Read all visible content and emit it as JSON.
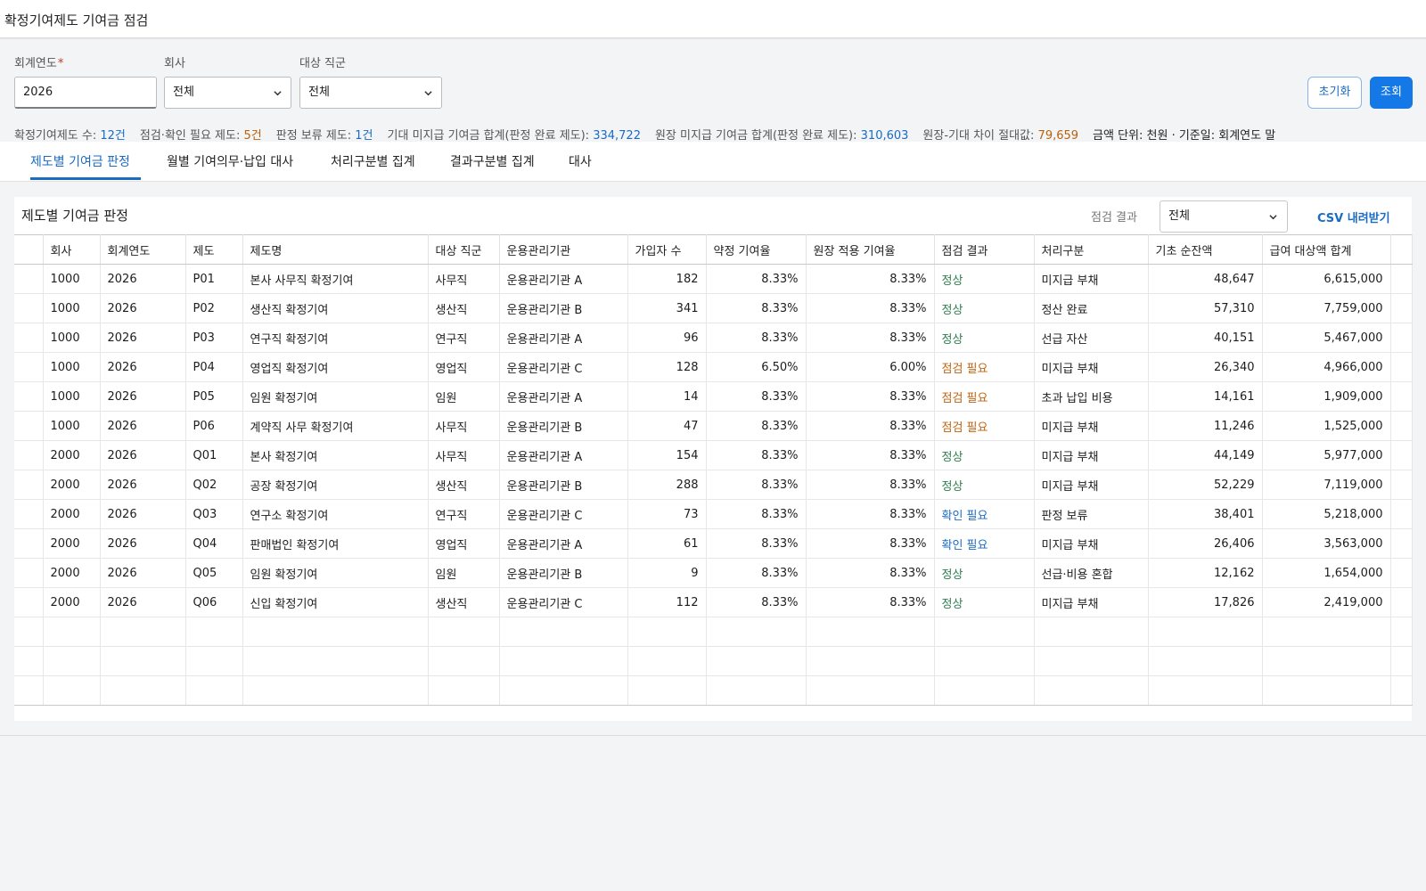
{
  "window": {
    "title": "확정기여제도 기여금 점검"
  },
  "filters": {
    "fiscal_year": {
      "label": "회계연도",
      "required_mark": "*",
      "value": "2026"
    },
    "company": {
      "label": "회사",
      "value": "전체"
    },
    "job_group": {
      "label": "대상 직군",
      "value": "전체"
    }
  },
  "buttons": {
    "reset": "초기화",
    "search": "조회"
  },
  "summary": {
    "plan_count_label": "확정기여제도 수:",
    "plan_count": "12건",
    "needs_check_label": "점검·확인 필요 제도:",
    "needs_check": "5건",
    "on_hold_label": "판정 보류 제도:",
    "on_hold": "1건",
    "expected_unpaid_label": "기대 미지급 기여금 합계(판정 완료 제도):",
    "expected_unpaid": "334,722",
    "ledger_unpaid_label": "원장 미지급 기여금 합계(판정 완료 제도):",
    "ledger_unpaid": "310,603",
    "diff_label": "원장-기대 차이 절대값:",
    "diff": "79,659",
    "unit_note": "금액 단위: 천원 · 기준일: 회계연도 말"
  },
  "tabs": [
    {
      "label": "제도별 기여금 판정",
      "active": true
    },
    {
      "label": "월별 기여의무·납입 대사"
    },
    {
      "label": "처리구분별 집계"
    },
    {
      "label": "결과구분별 집계"
    },
    {
      "label": "대사"
    }
  ],
  "panel": {
    "title": "제도별 기여금 판정",
    "result_filter_label": "점검 결과",
    "result_filter_value": "전체",
    "csv_label": "CSV 내려받기"
  },
  "table": {
    "columns": [
      "회사",
      "회계연도",
      "제도",
      "제도명",
      "대상 직군",
      "운용관리기관",
      "가입자 수",
      "약정 기여율",
      "원장 적용 기여율",
      "점검 결과",
      "처리구분",
      "기초 순잔액",
      "급여 대상액 합계"
    ],
    "rows": [
      [
        "1000",
        "2026",
        "P01",
        "본사 사무직 확정기여",
        "사무직",
        "운용관리기관 A",
        "182",
        "8.33%",
        "8.33%",
        "정상",
        "미지급 부채",
        "48,647",
        "6,615,000"
      ],
      [
        "1000",
        "2026",
        "P02",
        "생산직 확정기여",
        "생산직",
        "운용관리기관 B",
        "341",
        "8.33%",
        "8.33%",
        "정상",
        "정산 완료",
        "57,310",
        "7,759,000"
      ],
      [
        "1000",
        "2026",
        "P03",
        "연구직 확정기여",
        "연구직",
        "운용관리기관 A",
        "96",
        "8.33%",
        "8.33%",
        "정상",
        "선급 자산",
        "40,151",
        "5,467,000"
      ],
      [
        "1000",
        "2026",
        "P04",
        "영업직 확정기여",
        "영업직",
        "운용관리기관 C",
        "128",
        "6.50%",
        "6.00%",
        "점검 필요",
        "미지급 부채",
        "26,340",
        "4,966,000"
      ],
      [
        "1000",
        "2026",
        "P05",
        "임원 확정기여",
        "임원",
        "운용관리기관 A",
        "14",
        "8.33%",
        "8.33%",
        "점검 필요",
        "초과 납입 비용",
        "14,161",
        "1,909,000"
      ],
      [
        "1000",
        "2026",
        "P06",
        "계약직 사무 확정기여",
        "사무직",
        "운용관리기관 B",
        "47",
        "8.33%",
        "8.33%",
        "점검 필요",
        "미지급 부채",
        "11,246",
        "1,525,000"
      ],
      [
        "2000",
        "2026",
        "Q01",
        "본사 확정기여",
        "사무직",
        "운용관리기관 A",
        "154",
        "8.33%",
        "8.33%",
        "정상",
        "미지급 부채",
        "44,149",
        "5,977,000"
      ],
      [
        "2000",
        "2026",
        "Q02",
        "공장 확정기여",
        "생산직",
        "운용관리기관 B",
        "288",
        "8.33%",
        "8.33%",
        "정상",
        "미지급 부채",
        "52,229",
        "7,119,000"
      ],
      [
        "2000",
        "2026",
        "Q03",
        "연구소 확정기여",
        "연구직",
        "운용관리기관 C",
        "73",
        "8.33%",
        "8.33%",
        "확인 필요",
        "판정 보류",
        "38,401",
        "5,218,000"
      ],
      [
        "2000",
        "2026",
        "Q04",
        "판매법인 확정기여",
        "영업직",
        "운용관리기관 A",
        "61",
        "8.33%",
        "8.33%",
        "확인 필요",
        "미지급 부채",
        "26,406",
        "3,563,000"
      ],
      [
        "2000",
        "2026",
        "Q05",
        "임원 확정기여",
        "임원",
        "운용관리기관 B",
        "9",
        "8.33%",
        "8.33%",
        "정상",
        "선급·비용 혼합",
        "12,162",
        "1,654,000"
      ],
      [
        "2000",
        "2026",
        "Q06",
        "신입 확정기여",
        "생산직",
        "운용관리기관 C",
        "112",
        "8.33%",
        "8.33%",
        "정상",
        "미지급 부채",
        "17,826",
        "2,419,000"
      ]
    ],
    "empty_rows": 3
  },
  "colors": {
    "accent": "#1a6bc4",
    "status_normal": "#2e7d4f",
    "status_check_needed": "#c0620e",
    "status_confirm_needed": "#1a6bc4"
  }
}
